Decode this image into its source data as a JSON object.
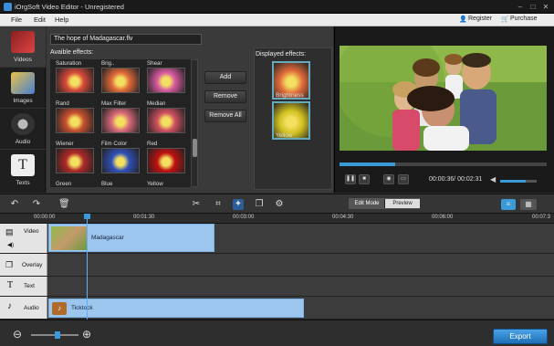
{
  "window": {
    "title": "iOrgSoft Video Editor - Unregistered"
  },
  "menu": {
    "items": [
      "File",
      "Edit",
      "Help"
    ],
    "register": "Register",
    "purchase": "Purchase"
  },
  "sidebar": {
    "items": [
      {
        "label": "Videos",
        "icon": "film-icon"
      },
      {
        "label": "Images",
        "icon": "image-icon"
      },
      {
        "label": "Audio",
        "icon": "audio-icon"
      },
      {
        "label": "Texts",
        "icon": "text-icon"
      }
    ]
  },
  "effects": {
    "file_name": "The  hope of  Madagascar.flv",
    "available_label": "Avaible effects:",
    "items": [
      {
        "label": "Saturation",
        "color": "#d84a3a"
      },
      {
        "label": "Brig..",
        "color": "#e06a3a"
      },
      {
        "label": "Shear",
        "color": "#d85aa0"
      },
      {
        "label": "Rand",
        "color": "#c85030"
      },
      {
        "label": "Max Filter",
        "color": "#d86a7a"
      },
      {
        "label": "Median",
        "color": "#d05060"
      },
      {
        "label": "Wiener",
        "color": "#b02828"
      },
      {
        "label": "Film Color",
        "color": "#3050b8"
      },
      {
        "label": "Red",
        "color": "#c01010"
      },
      {
        "label": "Green",
        "color": "#20a020"
      },
      {
        "label": "Blue",
        "color": "#1020a0"
      },
      {
        "label": "Yellow",
        "color": "#d0c020"
      }
    ],
    "buttons": {
      "add": "Add",
      "remove": "Remove",
      "remove_all": "Remove All"
    },
    "displayed_label": "Displayed effects:",
    "displayed": [
      {
        "label": "Brightness",
        "color": "#e06a3a"
      },
      {
        "label": "Yellow",
        "color": "#d0c020"
      }
    ]
  },
  "player": {
    "progress": 0.27,
    "time": "00:00:36/ 00:02:31",
    "volume": 0.7
  },
  "toolbar": {
    "edit_mode": "Edit Mode",
    "preview": "Preview"
  },
  "ruler": {
    "ticks": [
      "00:00:00",
      "00:01:30",
      "00:03:00",
      "00:04:30",
      "00:06:00",
      "00:07:3"
    ]
  },
  "tracks": [
    {
      "name": "Video",
      "clip": "Madagascar"
    },
    {
      "name": "Overlay",
      "clip": ""
    },
    {
      "name": "Text",
      "clip": ""
    },
    {
      "name": "Audio",
      "clip": "Ticktock"
    }
  ],
  "bottom": {
    "export": "Export",
    "zoom_out": "⊖",
    "zoom_in": "⊕"
  },
  "colors": {
    "accent": "#3a9ad8",
    "panel": "#3a3a3a",
    "track_header": "#e4e4e4",
    "clip": "#9dc6ef"
  }
}
